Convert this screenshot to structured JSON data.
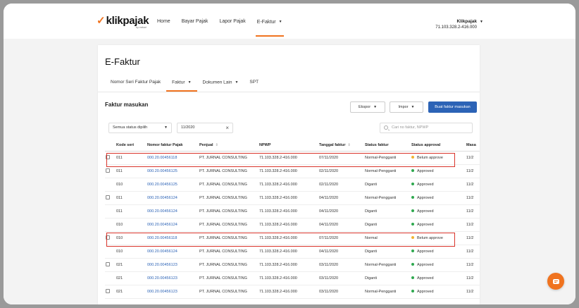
{
  "brand": {
    "logo_text": "klikpajak",
    "logo_sub": "by mekari"
  },
  "nav": [
    {
      "label": "Home"
    },
    {
      "label": "Bayar Pajak"
    },
    {
      "label": "Lapor Pajak"
    },
    {
      "label": "E-Faktur"
    }
  ],
  "user": {
    "name": "Klikpajak",
    "npwp": "71.103.328.2-416.000"
  },
  "page": {
    "title": "E-Faktur"
  },
  "tabs": [
    {
      "label": "Nomor Seri Faktur Pajak"
    },
    {
      "label": "Faktur"
    },
    {
      "label": "Dokumen Lain"
    },
    {
      "label": "SPT"
    }
  ],
  "section": {
    "title": "Faktur masukan"
  },
  "actions": {
    "ekspor": "Ekspor",
    "impor": "Impor",
    "buat": "Buat faktur masukan"
  },
  "filters": {
    "status": "Semua status dipilih",
    "period": "11/2020",
    "search_placeholder": "Cari no faktur, NPWP"
  },
  "table": {
    "headers": [
      "",
      "Kode seri",
      "Nomor faktur Pajak",
      "Penjual",
      "NPWP",
      "Tanggal faktur",
      "Status faktur",
      "Status approval",
      "Masa"
    ],
    "rows": [
      {
        "check": true,
        "kode": "011",
        "nomor": "000.20.00456118",
        "penjual": "PT. JURNAL CONSULTING",
        "npwp": "71.103.328.2-416.000",
        "tanggal": "07/11/2020",
        "status": "Normal-Pengganti",
        "approval": "Belum approve",
        "masa": "11/2"
      },
      {
        "check": true,
        "kode": "011",
        "nomor": "000.20.00456125",
        "penjual": "PT. JURNAL CONSULTING",
        "npwp": "71.103.328.2-416.000",
        "tanggal": "02/11/2020",
        "status": "Normal-Pengganti",
        "approval": "Approved",
        "masa": "11/2"
      },
      {
        "check": false,
        "kode": "010",
        "nomor": "000.20.00456125",
        "penjual": "PT. JURNAL CONSULTING",
        "npwp": "71.103.328.2-416.000",
        "tanggal": "02/11/2020",
        "status": "Diganti",
        "approval": "Approved",
        "masa": "11/2"
      },
      {
        "check": true,
        "kode": "011",
        "nomor": "000.20.00456124",
        "penjual": "PT. JURNAL CONSULTING",
        "npwp": "71.103.328.2-416.000",
        "tanggal": "04/11/2020",
        "status": "Normal-Pengganti",
        "approval": "Approved",
        "masa": "11/2"
      },
      {
        "check": false,
        "kode": "011",
        "nomor": "000.20.00456124",
        "penjual": "PT. JURNAL CONSULTING",
        "npwp": "71.103.328.2-416.000",
        "tanggal": "04/11/2020",
        "status": "Diganti",
        "approval": "Approved",
        "masa": "11/2"
      },
      {
        "check": false,
        "kode": "010",
        "nomor": "000.20.00456124",
        "penjual": "PT. JURNAL CONSULTING",
        "npwp": "71.103.328.2-416.000",
        "tanggal": "04/11/2020",
        "status": "Diganti",
        "approval": "Approved",
        "masa": "11/2"
      },
      {
        "check": true,
        "kode": "010",
        "nomor": "000.20.00456118",
        "penjual": "PT. JURNAL CONSULTING",
        "npwp": "71.103.328.2-416.000",
        "tanggal": "07/11/2020",
        "status": "Normal",
        "approval": "Belum approve",
        "masa": "11/2"
      },
      {
        "check": false,
        "kode": "010",
        "nomor": "000.20.00456124",
        "penjual": "PT. JURNAL CONSULTING",
        "npwp": "71.103.328.2-416.000",
        "tanggal": "04/11/2020",
        "status": "Diganti",
        "approval": "Approved",
        "masa": "11/2"
      },
      {
        "check": true,
        "kode": "021",
        "nomor": "000.20.00456123",
        "penjual": "PT. JURNAL CONSULTING",
        "npwp": "71.103.328.2-416.000",
        "tanggal": "03/11/2020",
        "status": "Normal-Pengganti",
        "approval": "Approved",
        "masa": "11/2"
      },
      {
        "check": false,
        "kode": "021",
        "nomor": "000.20.00456123",
        "penjual": "PT. JURNAL CONSULTING",
        "npwp": "71.103.328.2-416.000",
        "tanggal": "03/11/2020",
        "status": "Diganti",
        "approval": "Approved",
        "masa": "11/2"
      },
      {
        "check": true,
        "kode": "021",
        "nomor": "000.20.00456123",
        "penjual": "PT. JURNAL CONSULTING",
        "npwp": "71.103.328.2-416.000",
        "tanggal": "03/11/2020",
        "status": "Normal-Pengganti",
        "approval": "Approved",
        "masa": "11/2"
      }
    ]
  },
  "colors": {
    "accent": "#f0731f",
    "primary": "#2c63b6",
    "approved": "#2fa84f",
    "pending": "#f2b233",
    "highlight": "#d9342b"
  }
}
